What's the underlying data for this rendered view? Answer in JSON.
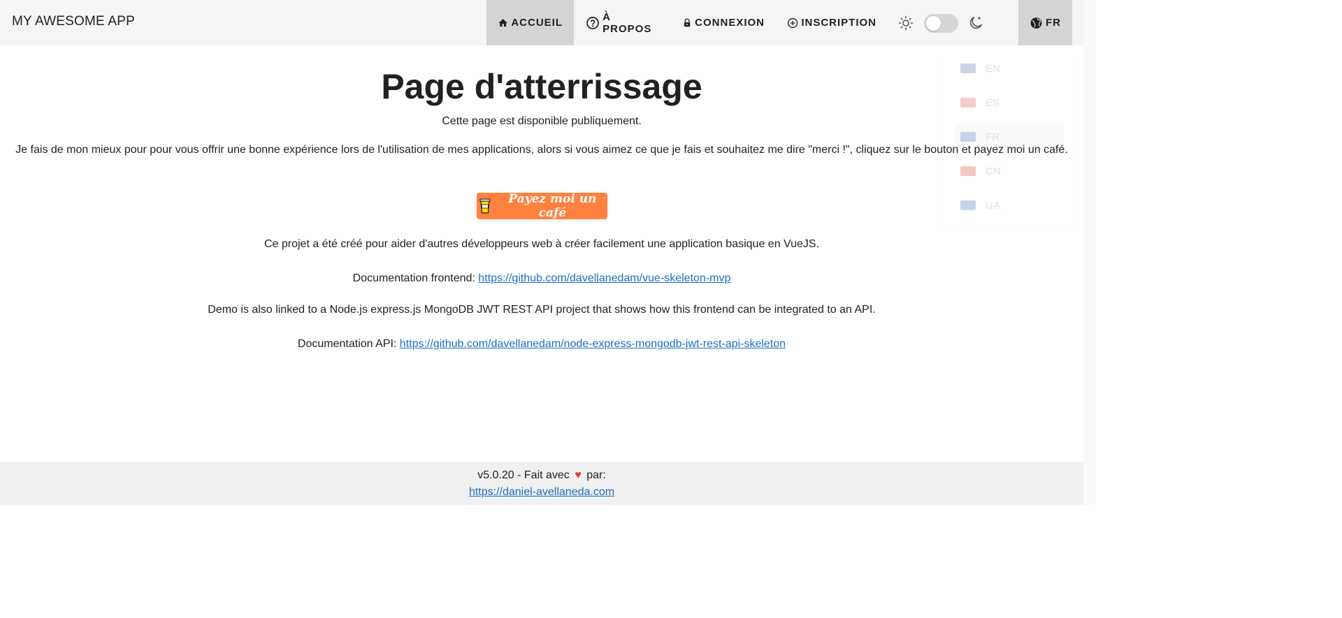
{
  "app": {
    "brand": "MY AWESOME APP"
  },
  "nav": {
    "home": "ACCUEIL",
    "about": "À PROPOS",
    "login": "CONNEXION",
    "signup": "INSCRIPTION",
    "lang": "FR"
  },
  "theme": {
    "dark_mode": false
  },
  "lang_menu": {
    "items": [
      {
        "code": "EN",
        "flag_color": "#3b5998"
      },
      {
        "code": "ES",
        "flag_color": "#d9363e"
      },
      {
        "code": "FR",
        "flag_color": "#2b4fa0",
        "selected": true
      },
      {
        "code": "CN",
        "flag_color": "#de2910"
      },
      {
        "code": "UA",
        "flag_color": "#1e5fb8"
      }
    ]
  },
  "main": {
    "title": "Page d'atterrissage",
    "public_text": "Cette page est disponible publiquement.",
    "merci_text": "Je fais de mon mieux pour pour vous offrir une bonne expérience lors de l'utilisation de mes applications, alors si vous aimez ce que je fais et souhaitez me dire \"merci !\", cliquez sur le bouton et payez moi un café.",
    "coffee_button": "Payez moi un café",
    "project_text": "Ce projet a été créé pour aider d'autres développeurs web à créer facilement une application basique en VueJS.",
    "doc_front_label": "Documentation frontend: ",
    "doc_front_link": "https://github.com/davellanedam/vue-skeleton-mvp",
    "demo_text": "Demo is also linked to a Node.js express.js MongoDB JWT REST API project that shows how this frontend can be integrated to an API.",
    "doc_api_label": "Documentation API: ",
    "doc_api_link": "https://github.com/davellanedam/node-express-mongodb-jwt-rest-api-skeleton"
  },
  "footer": {
    "version_text": "v5.0.20 - Fait avec",
    "par_text": "par:",
    "site_link": "https://daniel-avellaneda.com"
  },
  "colors": {
    "appbar": "#f5f5f5",
    "active_nav": "#d4d4d4",
    "coffee": "#ff813f",
    "link": "#1a6fc4",
    "heart": "#e53935"
  }
}
